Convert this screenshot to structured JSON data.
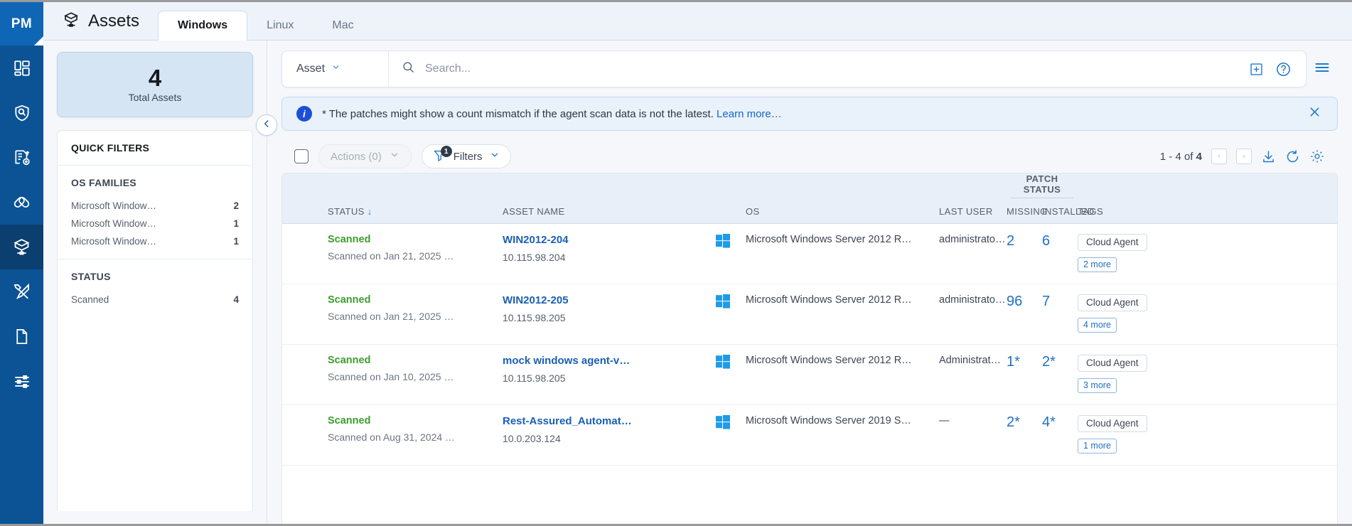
{
  "brand": {
    "logo_text": "PM",
    "accent": "#0b5394",
    "link_blue": "#1a5fb4",
    "status_green": "#3e9c2f"
  },
  "rail": {
    "items": [
      {
        "name": "dashboard-icon",
        "label": "Dashboard"
      },
      {
        "name": "scan-shield-icon",
        "label": "Scans"
      },
      {
        "name": "report-icon",
        "label": "Reports"
      },
      {
        "name": "patches-icon",
        "label": "Patches"
      },
      {
        "name": "assets-icon",
        "label": "Assets"
      },
      {
        "name": "tools-icon",
        "label": "Tools"
      },
      {
        "name": "document-icon",
        "label": "Documents"
      },
      {
        "name": "settings-sliders-icon",
        "label": "Configuration"
      }
    ]
  },
  "header": {
    "title": "Assets",
    "title_icon": "assets-cube-icon",
    "tabs": [
      {
        "label": "Windows",
        "active": true
      },
      {
        "label": "Linux",
        "active": false
      },
      {
        "label": "Mac",
        "active": false
      }
    ]
  },
  "left_panel": {
    "kpi": {
      "value": "4",
      "label": "Total Assets"
    },
    "collapse_icon": "chevron-left-icon",
    "quick_filters_title": "QUICK FILTERS",
    "groups": [
      {
        "title": "OS FAMILIES",
        "rows": [
          {
            "label": "Microsoft Window…",
            "count": "2"
          },
          {
            "label": "Microsoft Window…",
            "count": "1"
          },
          {
            "label": "Microsoft Window…",
            "count": "1"
          }
        ]
      },
      {
        "title": "STATUS",
        "rows": [
          {
            "label": "Scanned",
            "count": "4"
          }
        ]
      }
    ]
  },
  "search": {
    "scope_label": "Asset",
    "scope_caret": "chevron-down-icon",
    "placeholder": "Search...",
    "value": "",
    "search_icon": "search-icon",
    "add_icon": "add-box-icon",
    "help_icon": "help-circle-icon",
    "menu_icon": "hamburger-menu-icon"
  },
  "notice": {
    "icon": "info-icon",
    "text": "* The patches might show a count mismatch if the agent scan data is not the latest.",
    "link_text": "Learn more…",
    "close_icon": "close-icon"
  },
  "toolbar": {
    "select_all_name": "select-all-checkbox",
    "actions_label": "Actions (0)",
    "filters_label": "Filters",
    "filters_badge": "1",
    "pagination": "1 - 4 of",
    "pagination_total": "4",
    "prev_glyph": "‹",
    "next_glyph": "›",
    "download_icon": "download-icon",
    "refresh_icon": "refresh-icon",
    "settings_icon": "gear-icon"
  },
  "table": {
    "group_header": "PATCH STATUS",
    "columns": {
      "status": "STATUS",
      "sort_glyph": "↓",
      "asset_name": "ASSET NAME",
      "os": "OS",
      "last_user": "LAST USER",
      "missing": "MISSING",
      "installed": "INSTALLED",
      "tags": "TAGS"
    },
    "rows": [
      {
        "status": "Scanned",
        "status_sub": "Scanned on Jan 21, 2025 …",
        "asset_name": "WIN2012-204",
        "ip": "10.115.98.204",
        "os_icon": "windows-icon",
        "os": "Microsoft Windows Server 2012 R…",
        "last_user": "administrato…",
        "missing": "2",
        "installed": "6",
        "tag": "Cloud Agent",
        "tag_more": "2 more"
      },
      {
        "status": "Scanned",
        "status_sub": "Scanned on Jan 21, 2025 …",
        "asset_name": "WIN2012-205",
        "ip": "10.115.98.205",
        "os_icon": "windows-icon",
        "os": "Microsoft Windows Server 2012 R…",
        "last_user": "administrato…",
        "missing": "96",
        "installed": "7",
        "tag": "Cloud Agent",
        "tag_more": "4 more"
      },
      {
        "status": "Scanned",
        "status_sub": "Scanned on Jan 10, 2025 …",
        "asset_name": "mock windows agent-v…",
        "ip": "10.115.98.205",
        "os_icon": "windows-icon",
        "os": "Microsoft Windows Server 2012 R…",
        "last_user": "Administrato…",
        "missing": "1*",
        "installed": "2*",
        "tag": "Cloud Agent",
        "tag_more": "3 more"
      },
      {
        "status": "Scanned",
        "status_sub": "Scanned on Aug 31, 2024 …",
        "asset_name": "Rest-Assured_Automat…",
        "ip": "10.0.203.124",
        "os_icon": "windows-icon",
        "os": "Microsoft Windows Server 2019 S…",
        "last_user": "—",
        "missing": "2*",
        "installed": "4*",
        "tag": "Cloud Agent",
        "tag_more": "1 more"
      }
    ]
  }
}
